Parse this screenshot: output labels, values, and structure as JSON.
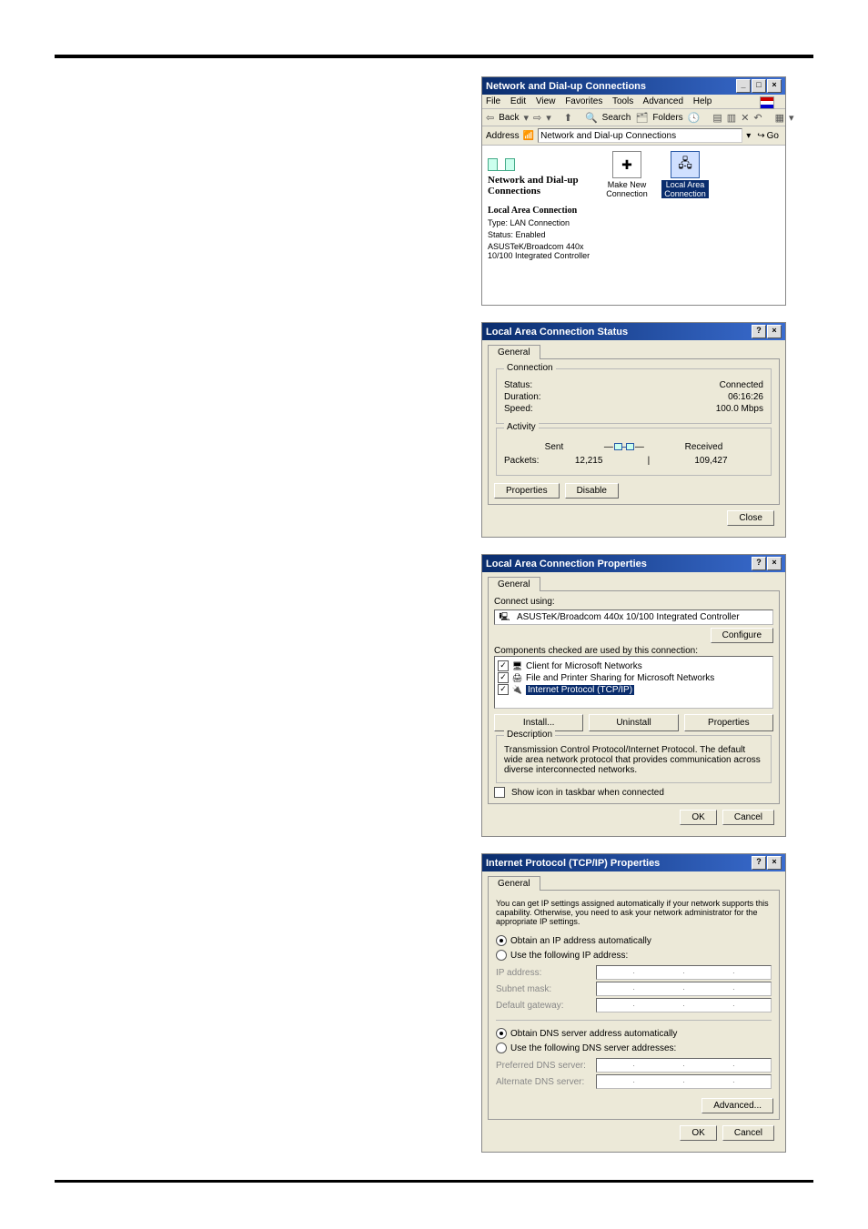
{
  "explorer": {
    "title": "Network and Dial-up Connections",
    "menu": [
      "File",
      "Edit",
      "View",
      "Favorites",
      "Tools",
      "Advanced",
      "Help"
    ],
    "toolbar": {
      "back": "Back",
      "search": "Search",
      "folders": "Folders"
    },
    "address_label": "Address",
    "address_value": "Network and Dial-up Connections",
    "go": "Go",
    "left": {
      "heading": "Network and Dial-up Connections",
      "section": "Local Area Connection",
      "type": "Type: LAN Connection",
      "status": "Status: Enabled",
      "adapter": "ASUSTeK/Broadcom 440x 10/100 Integrated Controller"
    },
    "icons": {
      "make_new": "Make New Connection",
      "local_area": "Local Area Connection"
    }
  },
  "status": {
    "title": "Local Area Connection Status",
    "tab": "General",
    "g1": {
      "legend": "Connection",
      "status_l": "Status:",
      "status_v": "Connected",
      "duration_l": "Duration:",
      "duration_v": "06:16:26",
      "speed_l": "Speed:",
      "speed_v": "100.0 Mbps"
    },
    "g2": {
      "legend": "Activity",
      "sent": "Sent",
      "received": "Received",
      "packets_l": "Packets:",
      "packets_sent": "12,215",
      "packets_recv": "109,427"
    },
    "btn_props": "Properties",
    "btn_disable": "Disable",
    "btn_close": "Close"
  },
  "props": {
    "title": "Local Area Connection Properties",
    "tab": "General",
    "connect_using": "Connect using:",
    "adapter": "ASUSTeK/Broadcom 440x 10/100 Integrated Controller",
    "configure": "Configure",
    "comp_label": "Components checked are used by this connection:",
    "comps": {
      "c1": "Client for Microsoft Networks",
      "c2": "File and Printer Sharing for Microsoft Networks",
      "c3": "Internet Protocol (TCP/IP)"
    },
    "install": "Install...",
    "uninstall": "Uninstall",
    "properties": "Properties",
    "desc_legend": "Description",
    "desc": "Transmission Control Protocol/Internet Protocol. The default wide area network protocol that provides communication across diverse interconnected networks.",
    "show_icon": "Show icon in taskbar when connected",
    "ok": "OK",
    "cancel": "Cancel"
  },
  "tcpip": {
    "title": "Internet Protocol (TCP/IP) Properties",
    "tab": "General",
    "intro": "You can get IP settings assigned automatically if your network supports this capability. Otherwise, you need to ask your network administrator for the appropriate IP settings.",
    "r1": "Obtain an IP address automatically",
    "r2": "Use the following IP address:",
    "f1": "IP address:",
    "f2": "Subnet mask:",
    "f3": "Default gateway:",
    "r3": "Obtain DNS server address automatically",
    "r4": "Use the following DNS server addresses:",
    "f4": "Preferred DNS server:",
    "f5": "Alternate DNS server:",
    "advanced": "Advanced...",
    "ok": "OK",
    "cancel": "Cancel"
  }
}
